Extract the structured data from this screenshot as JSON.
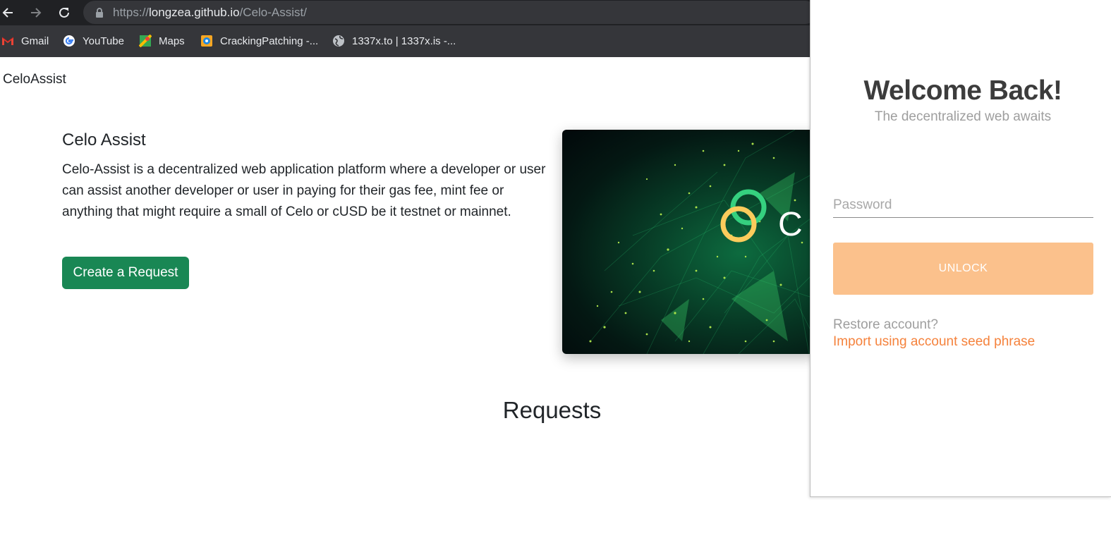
{
  "browser": {
    "url_scheme": "https://",
    "url_host": "longzea.github.io",
    "url_path": "/Celo-Assist/",
    "bookmarks": [
      {
        "label": "Gmail",
        "icon": "gmail-icon"
      },
      {
        "label": "YouTube",
        "icon": "google-icon"
      },
      {
        "label": "Maps",
        "icon": "maps-icon"
      },
      {
        "label": "CrackingPatching -...",
        "icon": "site-icon"
      },
      {
        "label": "1337x.to | 1337x.is -...",
        "icon": "globe-icon"
      }
    ]
  },
  "page": {
    "brand": "CeloAssist",
    "hero": {
      "title": "Celo Assist",
      "description": "Celo-Assist is a decentralized web application platform where a developer or user can assist another developer or user in paying for their gas fee, mint fee or anything that might require a small of Celo or cUSD be it testnet or mainnet.",
      "button_label": "Create a Request",
      "image_logo_text": "C"
    },
    "requests_heading": "Requests"
  },
  "wallet": {
    "title": "Welcome Back!",
    "subtitle": "The decentralized web awaits",
    "password_placeholder": "Password",
    "unlock_label": "UNLOCK",
    "restore_question": "Restore account?",
    "import_link": "Import using account seed phrase"
  },
  "colors": {
    "primary_button": "#198754",
    "unlock_button": "#fbc18c",
    "link_orange": "#f5823c",
    "browser_dark": "#202124"
  }
}
